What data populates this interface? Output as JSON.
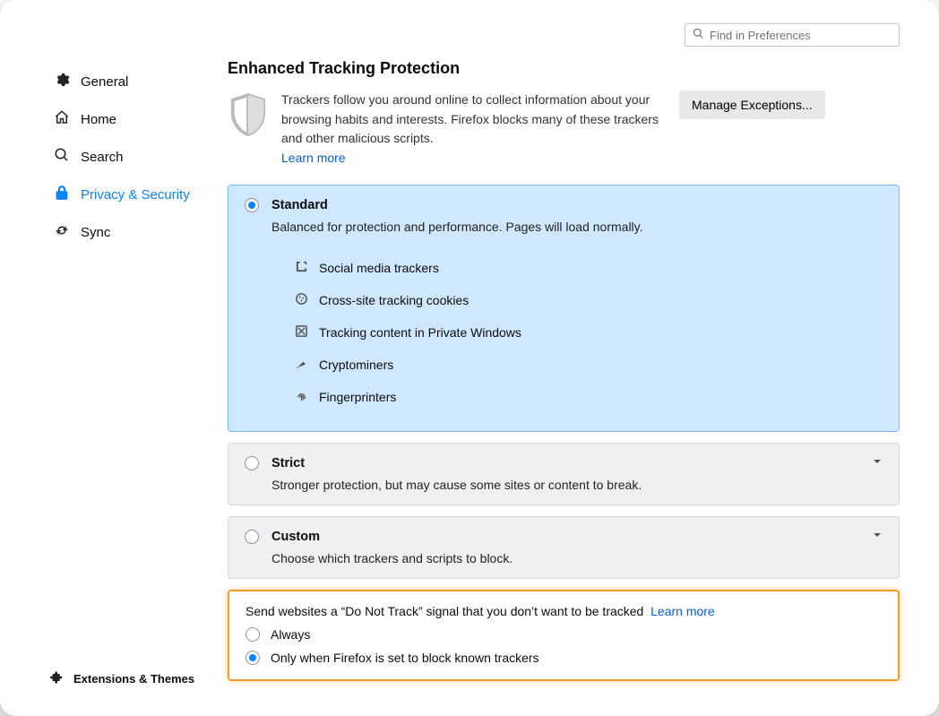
{
  "search_placeholder": "Find in Preferences",
  "sidebar": {
    "items": [
      {
        "label": "General"
      },
      {
        "label": "Home"
      },
      {
        "label": "Search"
      },
      {
        "label": "Privacy & Security"
      },
      {
        "label": "Sync"
      }
    ],
    "active_index": 3,
    "footer_label": "Extensions & Themes"
  },
  "etp": {
    "section_title": "Enhanced Tracking Protection",
    "summary": "Trackers follow you around online to collect information about your browsing habits and interests. Firefox blocks many of these trackers and other malicious scripts.",
    "learn_more": "Learn more",
    "manage_exceptions": "Manage Exceptions...",
    "options": [
      {
        "title": "Standard",
        "subtitle": "Balanced for protection and performance. Pages will load normally.",
        "selected": true,
        "trackers": [
          "Social media trackers",
          "Cross-site tracking cookies",
          "Tracking content in Private Windows",
          "Cryptominers",
          "Fingerprinters"
        ]
      },
      {
        "title": "Strict",
        "subtitle": "Stronger protection, but may cause some sites or content to break.",
        "selected": false
      },
      {
        "title": "Custom",
        "subtitle": "Choose which trackers and scripts to block.",
        "selected": false
      }
    ]
  },
  "dnt": {
    "intro": "Send websites a “Do Not Track” signal that you don’t want to be tracked",
    "learn_more": "Learn more",
    "options": [
      "Always",
      "Only when Firefox is set to block known trackers"
    ],
    "selected_index": 1
  }
}
